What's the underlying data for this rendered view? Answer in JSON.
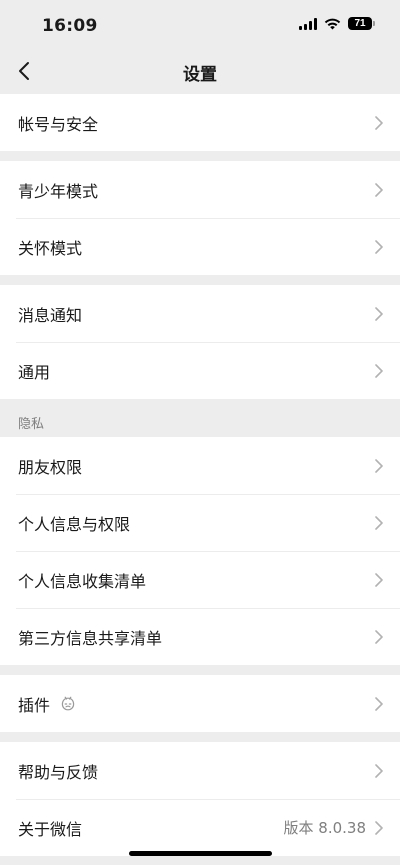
{
  "status_bar": {
    "time": "16:09",
    "battery": "71"
  },
  "nav": {
    "title": "设置"
  },
  "groups": {
    "account": {
      "row1": "帐号与安全"
    },
    "modes": {
      "row1": "青少年模式",
      "row2": "关怀模式"
    },
    "general": {
      "row1": "消息通知",
      "row2": "通用"
    },
    "privacy": {
      "section_label": "隐私",
      "row1": "朋友权限",
      "row2": "个人信息与权限",
      "row3": "个人信息收集清单",
      "row4": "第三方信息共享清单"
    },
    "plugins": {
      "row1": "插件"
    },
    "about": {
      "row1": "帮助与反馈",
      "row2": "关于微信",
      "version": "版本 8.0.38"
    }
  },
  "icons": {
    "back": "chevron-left-icon",
    "row_arrow": "chevron-right-icon",
    "plugin_badge": "plugin-icon"
  }
}
